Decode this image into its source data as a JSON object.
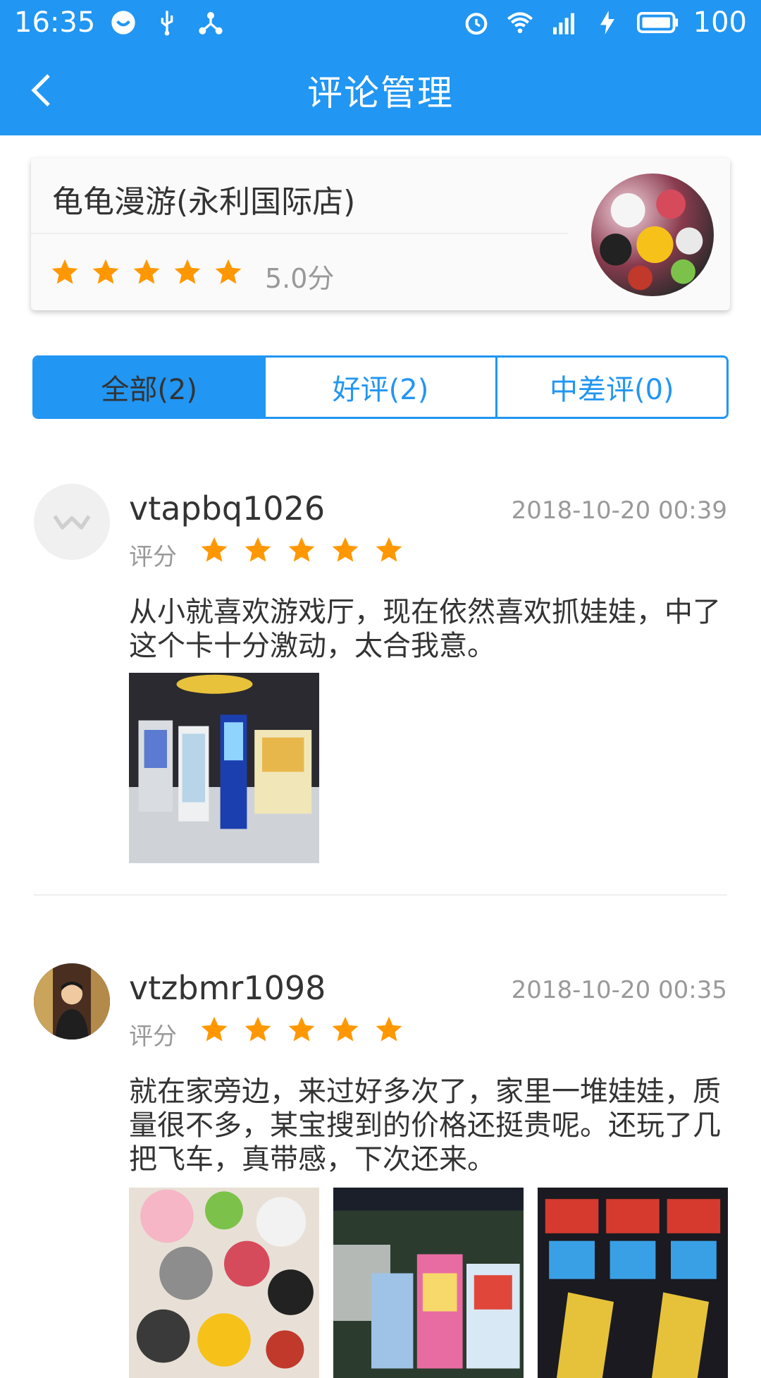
{
  "status_bar": {
    "time": "16:35",
    "battery": "100",
    "network": "4G"
  },
  "app_bar": {
    "title": "评论管理",
    "back_icon": "chevron-left-icon"
  },
  "store": {
    "name": "龟龟漫游(永利国际店)",
    "rating_stars": 5,
    "score_text": "5.0分"
  },
  "tabs": [
    {
      "label": "全部(2)",
      "active": true
    },
    {
      "label": "好评(2)",
      "active": false
    },
    {
      "label": "中差评(0)",
      "active": false
    }
  ],
  "reviews": [
    {
      "username": "vtapbq1026",
      "time": "2018-10-20 00:39",
      "rating_label": "评分",
      "stars": 5,
      "text": "从小就喜欢游戏厅，现在依然喜欢抓娃娃，中了这个卡十分激动，太合我意。",
      "image_count": 1
    },
    {
      "username": "vtzbmr1098",
      "time": "2018-10-20 00:35",
      "rating_label": "评分",
      "stars": 5,
      "text": "就在家旁边，来过好多次了，家里一堆娃娃，质量很不多，某宝搜到的价格还挺贵呢。还玩了几把飞车，真带感，下次还来。",
      "image_count": 3
    }
  ],
  "colors": {
    "primary": "#2196f3",
    "star": "#ff9800",
    "text_primary": "#333333",
    "text_secondary": "#999999"
  }
}
